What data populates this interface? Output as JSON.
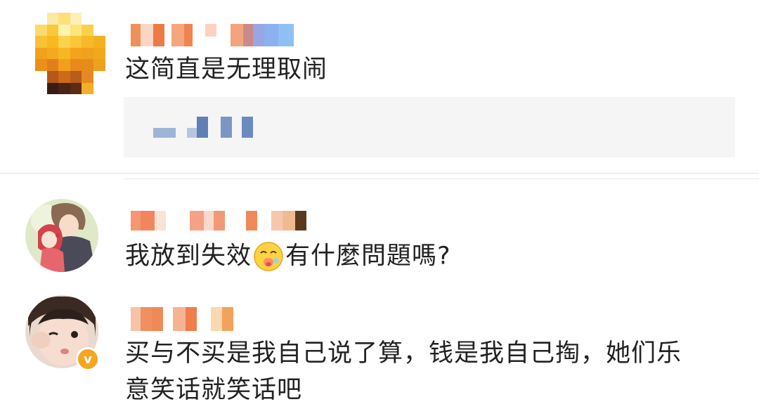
{
  "comments": [
    {
      "text": "这简直是无理取闹"
    },
    {
      "text_before_emoji": "我放到失效",
      "emoji": "drooling-face-icon",
      "text_after_emoji": "有什麼問題嗎?"
    },
    {
      "text_line1": "买与不买是我自己说了算，钱是我自己掏，她们乐",
      "text_line2": "意笑话就笑话吧",
      "verified_badge_label": "v"
    }
  ],
  "colors": {
    "text": "#222222",
    "reply_box_bg": "#f5f5f5",
    "divider": "#e2e2e2",
    "badge": "#f5a623"
  }
}
